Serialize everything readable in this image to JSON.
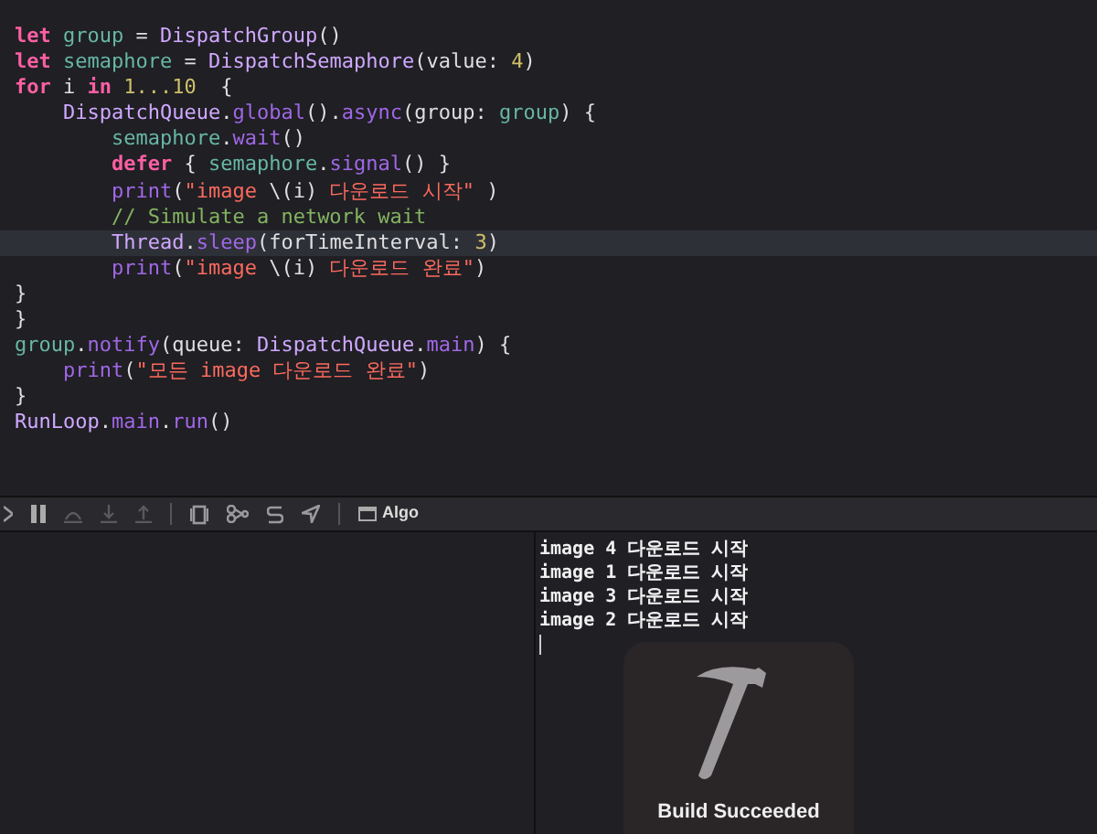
{
  "editor": {
    "lines": [
      {
        "tokens": [
          {
            "kind": "keyword",
            "text": "let"
          },
          {
            "kind": "variable",
            "text": " group"
          },
          {
            "kind": "plain",
            "text": " = "
          },
          {
            "kind": "type",
            "text": "DispatchGroup"
          },
          {
            "kind": "plain",
            "text": "()"
          }
        ],
        "highlighted": false
      },
      {
        "tokens": [
          {
            "kind": "keyword",
            "text": "let"
          },
          {
            "kind": "variable",
            "text": " semaphore"
          },
          {
            "kind": "plain",
            "text": " = "
          },
          {
            "kind": "type",
            "text": "DispatchSemaphore"
          },
          {
            "kind": "plain",
            "text": "(value: "
          },
          {
            "kind": "number",
            "text": "4"
          },
          {
            "kind": "plain",
            "text": ")"
          }
        ],
        "highlighted": false
      },
      {
        "tokens": [
          {
            "kind": "keyword",
            "text": "for"
          },
          {
            "kind": "plain",
            "text": " i "
          },
          {
            "kind": "keyword",
            "text": "in"
          },
          {
            "kind": "number",
            "text": " 1...10"
          },
          {
            "kind": "plain",
            "text": "  {"
          }
        ],
        "highlighted": false
      },
      {
        "tokens": [
          {
            "kind": "type",
            "text": "    DispatchQueue"
          },
          {
            "kind": "plain",
            "text": "."
          },
          {
            "kind": "function",
            "text": "global"
          },
          {
            "kind": "plain",
            "text": "()."
          },
          {
            "kind": "function",
            "text": "async"
          },
          {
            "kind": "plain",
            "text": "(group: "
          },
          {
            "kind": "variable",
            "text": "group"
          },
          {
            "kind": "plain",
            "text": ") {"
          }
        ],
        "highlighted": false
      },
      {
        "tokens": [
          {
            "kind": "variable",
            "text": "        semaphore"
          },
          {
            "kind": "plain",
            "text": "."
          },
          {
            "kind": "function",
            "text": "wait"
          },
          {
            "kind": "plain",
            "text": "()"
          }
        ],
        "highlighted": false
      },
      {
        "tokens": [
          {
            "kind": "keyword",
            "text": "        defer"
          },
          {
            "kind": "plain",
            "text": " { "
          },
          {
            "kind": "variable",
            "text": "semaphore"
          },
          {
            "kind": "plain",
            "text": "."
          },
          {
            "kind": "function",
            "text": "signal"
          },
          {
            "kind": "plain",
            "text": "() }"
          }
        ],
        "highlighted": false
      },
      {
        "tokens": [
          {
            "kind": "function",
            "text": "        print"
          },
          {
            "kind": "plain",
            "text": "("
          },
          {
            "kind": "string",
            "text": "\"image "
          },
          {
            "kind": "plain",
            "text": "\\(i)"
          },
          {
            "kind": "string",
            "text": " 다운로드 시작\""
          },
          {
            "kind": "plain",
            "text": " )"
          }
        ],
        "highlighted": false
      },
      {
        "tokens": [
          {
            "kind": "comment",
            "text": "        // Simulate a network wait"
          }
        ],
        "highlighted": false
      },
      {
        "tokens": [
          {
            "kind": "type",
            "text": "        Thread"
          },
          {
            "kind": "plain",
            "text": "."
          },
          {
            "kind": "function",
            "text": "sleep"
          },
          {
            "kind": "plain",
            "text": "(forTimeInterval: "
          },
          {
            "kind": "number",
            "text": "3"
          },
          {
            "kind": "plain",
            "text": ")"
          }
        ],
        "highlighted": true
      },
      {
        "tokens": [
          {
            "kind": "function",
            "text": "        print"
          },
          {
            "kind": "plain",
            "text": "("
          },
          {
            "kind": "string",
            "text": "\"image "
          },
          {
            "kind": "plain",
            "text": "\\(i)"
          },
          {
            "kind": "string",
            "text": " 다운로드 완료\""
          },
          {
            "kind": "plain",
            "text": ")"
          }
        ],
        "highlighted": false
      },
      {
        "tokens": [
          {
            "kind": "plain",
            "text": "}"
          }
        ],
        "highlighted": false
      },
      {
        "tokens": [
          {
            "kind": "plain",
            "text": "}"
          }
        ],
        "highlighted": false
      },
      {
        "tokens": [
          {
            "kind": "variable",
            "text": "group"
          },
          {
            "kind": "plain",
            "text": "."
          },
          {
            "kind": "function",
            "text": "notify"
          },
          {
            "kind": "plain",
            "text": "(queue: "
          },
          {
            "kind": "type",
            "text": "DispatchQueue"
          },
          {
            "kind": "plain",
            "text": "."
          },
          {
            "kind": "function",
            "text": "main"
          },
          {
            "kind": "plain",
            "text": ") {"
          }
        ],
        "highlighted": false
      },
      {
        "tokens": [
          {
            "kind": "function",
            "text": "    print"
          },
          {
            "kind": "plain",
            "text": "("
          },
          {
            "kind": "string",
            "text": "\"모든 image 다운로드 완료\""
          },
          {
            "kind": "plain",
            "text": ")"
          }
        ],
        "highlighted": false
      },
      {
        "tokens": [
          {
            "kind": "plain",
            "text": "}"
          }
        ],
        "highlighted": false
      },
      {
        "tokens": [
          {
            "kind": "type",
            "text": "RunLoop"
          },
          {
            "kind": "plain",
            "text": "."
          },
          {
            "kind": "function",
            "text": "main"
          },
          {
            "kind": "plain",
            "text": "."
          },
          {
            "kind": "function",
            "text": "run"
          },
          {
            "kind": "plain",
            "text": "()"
          }
        ],
        "highlighted": false
      }
    ]
  },
  "debug_bar": {
    "target_label": "Algo"
  },
  "console": {
    "lines": [
      "image 4 다운로드 시작",
      "image 1 다운로드 시작",
      "image 3 다운로드 시작",
      "image 2 다운로드 시작"
    ]
  },
  "hud": {
    "message": "Build Succeeded"
  }
}
